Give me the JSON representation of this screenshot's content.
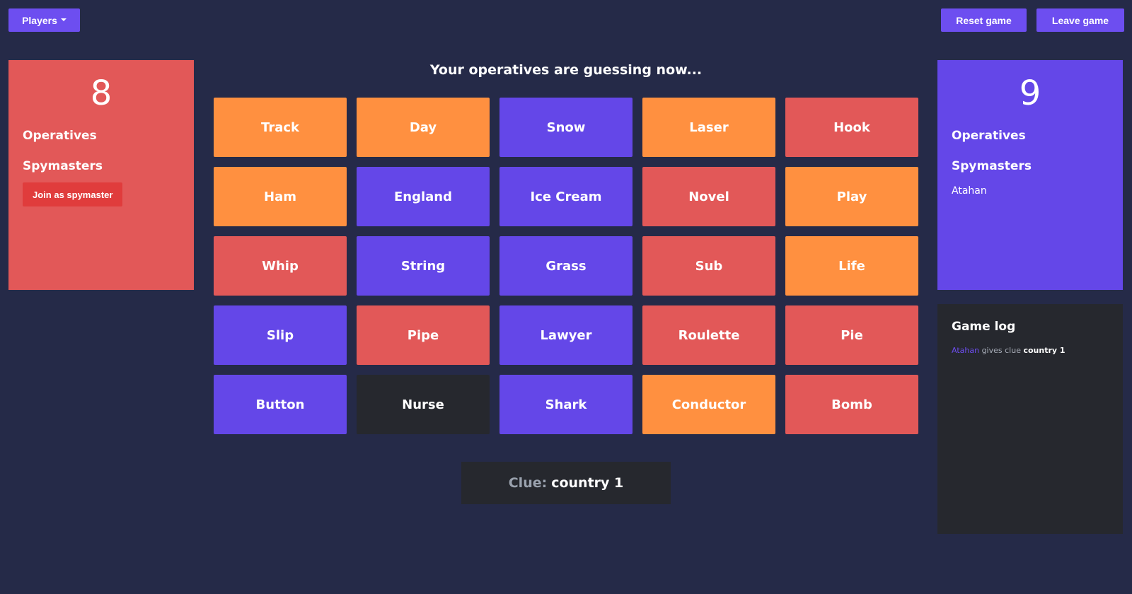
{
  "header": {
    "players_label": "Players",
    "reset_label": "Reset game",
    "leave_label": "Leave game"
  },
  "status": "Your operatives are guessing now...",
  "red_team": {
    "score": "8",
    "operatives_label": "Operatives",
    "spymasters_label": "Spymasters",
    "join_spymaster_label": "Join as spymaster"
  },
  "blue_team": {
    "score": "9",
    "operatives_label": "Operatives",
    "spymasters_label": "Spymasters",
    "spymasters": [
      "Atahan"
    ]
  },
  "board": {
    "cards": [
      {
        "word": "Track",
        "color": "orange"
      },
      {
        "word": "Day",
        "color": "orange"
      },
      {
        "word": "Snow",
        "color": "blue"
      },
      {
        "word": "Laser",
        "color": "orange"
      },
      {
        "word": "Hook",
        "color": "red"
      },
      {
        "word": "Ham",
        "color": "orange"
      },
      {
        "word": "England",
        "color": "blue"
      },
      {
        "word": "Ice Cream",
        "color": "blue"
      },
      {
        "word": "Novel",
        "color": "red"
      },
      {
        "word": "Play",
        "color": "orange"
      },
      {
        "word": "Whip",
        "color": "red"
      },
      {
        "word": "String",
        "color": "blue"
      },
      {
        "word": "Grass",
        "color": "blue"
      },
      {
        "word": "Sub",
        "color": "red"
      },
      {
        "word": "Life",
        "color": "orange"
      },
      {
        "word": "Slip",
        "color": "blue"
      },
      {
        "word": "Pipe",
        "color": "red"
      },
      {
        "word": "Lawyer",
        "color": "blue"
      },
      {
        "word": "Roulette",
        "color": "red"
      },
      {
        "word": "Pie",
        "color": "red"
      },
      {
        "word": "Button",
        "color": "blue"
      },
      {
        "word": "Nurse",
        "color": "black"
      },
      {
        "word": "Shark",
        "color": "blue"
      },
      {
        "word": "Conductor",
        "color": "orange"
      },
      {
        "word": "Bomb",
        "color": "red"
      }
    ]
  },
  "clue": {
    "label": "Clue:",
    "text": "country 1"
  },
  "game_log": {
    "title": "Game log",
    "entries": [
      {
        "player": "Atahan",
        "action": "gives clue",
        "clue": "country 1"
      }
    ]
  },
  "colors": {
    "background": "#252a48",
    "red": "#e25858",
    "blue": "#6447e8",
    "orange": "#ff9040",
    "black": "#26282e",
    "accent": "#6d4ef0"
  }
}
